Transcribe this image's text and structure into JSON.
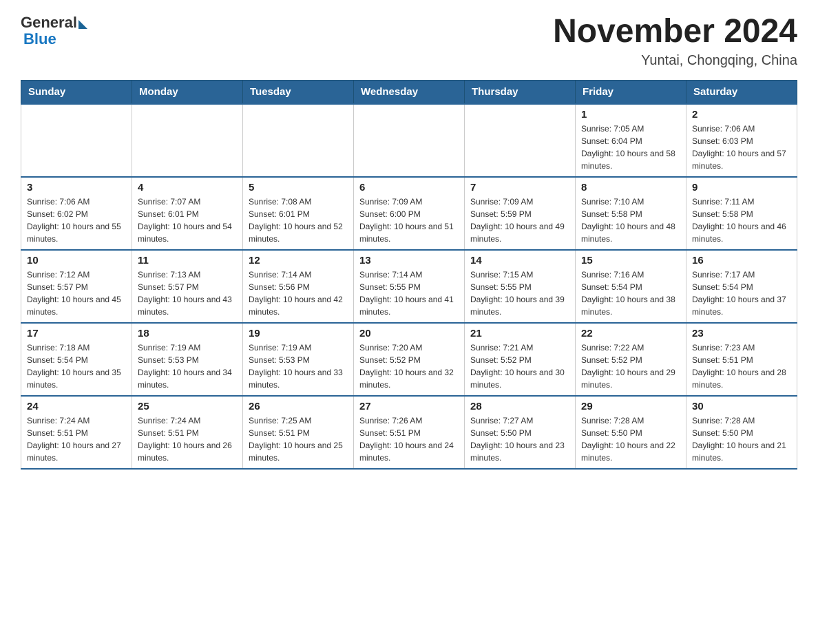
{
  "header": {
    "logo_general": "General",
    "logo_blue": "Blue",
    "title": "November 2024",
    "location": "Yuntai, Chongqing, China"
  },
  "weekdays": [
    "Sunday",
    "Monday",
    "Tuesday",
    "Wednesday",
    "Thursday",
    "Friday",
    "Saturday"
  ],
  "weeks": [
    [
      {
        "day": "",
        "sunrise": "",
        "sunset": "",
        "daylight": ""
      },
      {
        "day": "",
        "sunrise": "",
        "sunset": "",
        "daylight": ""
      },
      {
        "day": "",
        "sunrise": "",
        "sunset": "",
        "daylight": ""
      },
      {
        "day": "",
        "sunrise": "",
        "sunset": "",
        "daylight": ""
      },
      {
        "day": "",
        "sunrise": "",
        "sunset": "",
        "daylight": ""
      },
      {
        "day": "1",
        "sunrise": "Sunrise: 7:05 AM",
        "sunset": "Sunset: 6:04 PM",
        "daylight": "Daylight: 10 hours and 58 minutes."
      },
      {
        "day": "2",
        "sunrise": "Sunrise: 7:06 AM",
        "sunset": "Sunset: 6:03 PM",
        "daylight": "Daylight: 10 hours and 57 minutes."
      }
    ],
    [
      {
        "day": "3",
        "sunrise": "Sunrise: 7:06 AM",
        "sunset": "Sunset: 6:02 PM",
        "daylight": "Daylight: 10 hours and 55 minutes."
      },
      {
        "day": "4",
        "sunrise": "Sunrise: 7:07 AM",
        "sunset": "Sunset: 6:01 PM",
        "daylight": "Daylight: 10 hours and 54 minutes."
      },
      {
        "day": "5",
        "sunrise": "Sunrise: 7:08 AM",
        "sunset": "Sunset: 6:01 PM",
        "daylight": "Daylight: 10 hours and 52 minutes."
      },
      {
        "day": "6",
        "sunrise": "Sunrise: 7:09 AM",
        "sunset": "Sunset: 6:00 PM",
        "daylight": "Daylight: 10 hours and 51 minutes."
      },
      {
        "day": "7",
        "sunrise": "Sunrise: 7:09 AM",
        "sunset": "Sunset: 5:59 PM",
        "daylight": "Daylight: 10 hours and 49 minutes."
      },
      {
        "day": "8",
        "sunrise": "Sunrise: 7:10 AM",
        "sunset": "Sunset: 5:58 PM",
        "daylight": "Daylight: 10 hours and 48 minutes."
      },
      {
        "day": "9",
        "sunrise": "Sunrise: 7:11 AM",
        "sunset": "Sunset: 5:58 PM",
        "daylight": "Daylight: 10 hours and 46 minutes."
      }
    ],
    [
      {
        "day": "10",
        "sunrise": "Sunrise: 7:12 AM",
        "sunset": "Sunset: 5:57 PM",
        "daylight": "Daylight: 10 hours and 45 minutes."
      },
      {
        "day": "11",
        "sunrise": "Sunrise: 7:13 AM",
        "sunset": "Sunset: 5:57 PM",
        "daylight": "Daylight: 10 hours and 43 minutes."
      },
      {
        "day": "12",
        "sunrise": "Sunrise: 7:14 AM",
        "sunset": "Sunset: 5:56 PM",
        "daylight": "Daylight: 10 hours and 42 minutes."
      },
      {
        "day": "13",
        "sunrise": "Sunrise: 7:14 AM",
        "sunset": "Sunset: 5:55 PM",
        "daylight": "Daylight: 10 hours and 41 minutes."
      },
      {
        "day": "14",
        "sunrise": "Sunrise: 7:15 AM",
        "sunset": "Sunset: 5:55 PM",
        "daylight": "Daylight: 10 hours and 39 minutes."
      },
      {
        "day": "15",
        "sunrise": "Sunrise: 7:16 AM",
        "sunset": "Sunset: 5:54 PM",
        "daylight": "Daylight: 10 hours and 38 minutes."
      },
      {
        "day": "16",
        "sunrise": "Sunrise: 7:17 AM",
        "sunset": "Sunset: 5:54 PM",
        "daylight": "Daylight: 10 hours and 37 minutes."
      }
    ],
    [
      {
        "day": "17",
        "sunrise": "Sunrise: 7:18 AM",
        "sunset": "Sunset: 5:54 PM",
        "daylight": "Daylight: 10 hours and 35 minutes."
      },
      {
        "day": "18",
        "sunrise": "Sunrise: 7:19 AM",
        "sunset": "Sunset: 5:53 PM",
        "daylight": "Daylight: 10 hours and 34 minutes."
      },
      {
        "day": "19",
        "sunrise": "Sunrise: 7:19 AM",
        "sunset": "Sunset: 5:53 PM",
        "daylight": "Daylight: 10 hours and 33 minutes."
      },
      {
        "day": "20",
        "sunrise": "Sunrise: 7:20 AM",
        "sunset": "Sunset: 5:52 PM",
        "daylight": "Daylight: 10 hours and 32 minutes."
      },
      {
        "day": "21",
        "sunrise": "Sunrise: 7:21 AM",
        "sunset": "Sunset: 5:52 PM",
        "daylight": "Daylight: 10 hours and 30 minutes."
      },
      {
        "day": "22",
        "sunrise": "Sunrise: 7:22 AM",
        "sunset": "Sunset: 5:52 PM",
        "daylight": "Daylight: 10 hours and 29 minutes."
      },
      {
        "day": "23",
        "sunrise": "Sunrise: 7:23 AM",
        "sunset": "Sunset: 5:51 PM",
        "daylight": "Daylight: 10 hours and 28 minutes."
      }
    ],
    [
      {
        "day": "24",
        "sunrise": "Sunrise: 7:24 AM",
        "sunset": "Sunset: 5:51 PM",
        "daylight": "Daylight: 10 hours and 27 minutes."
      },
      {
        "day": "25",
        "sunrise": "Sunrise: 7:24 AM",
        "sunset": "Sunset: 5:51 PM",
        "daylight": "Daylight: 10 hours and 26 minutes."
      },
      {
        "day": "26",
        "sunrise": "Sunrise: 7:25 AM",
        "sunset": "Sunset: 5:51 PM",
        "daylight": "Daylight: 10 hours and 25 minutes."
      },
      {
        "day": "27",
        "sunrise": "Sunrise: 7:26 AM",
        "sunset": "Sunset: 5:51 PM",
        "daylight": "Daylight: 10 hours and 24 minutes."
      },
      {
        "day": "28",
        "sunrise": "Sunrise: 7:27 AM",
        "sunset": "Sunset: 5:50 PM",
        "daylight": "Daylight: 10 hours and 23 minutes."
      },
      {
        "day": "29",
        "sunrise": "Sunrise: 7:28 AM",
        "sunset": "Sunset: 5:50 PM",
        "daylight": "Daylight: 10 hours and 22 minutes."
      },
      {
        "day": "30",
        "sunrise": "Sunrise: 7:28 AM",
        "sunset": "Sunset: 5:50 PM",
        "daylight": "Daylight: 10 hours and 21 minutes."
      }
    ]
  ]
}
